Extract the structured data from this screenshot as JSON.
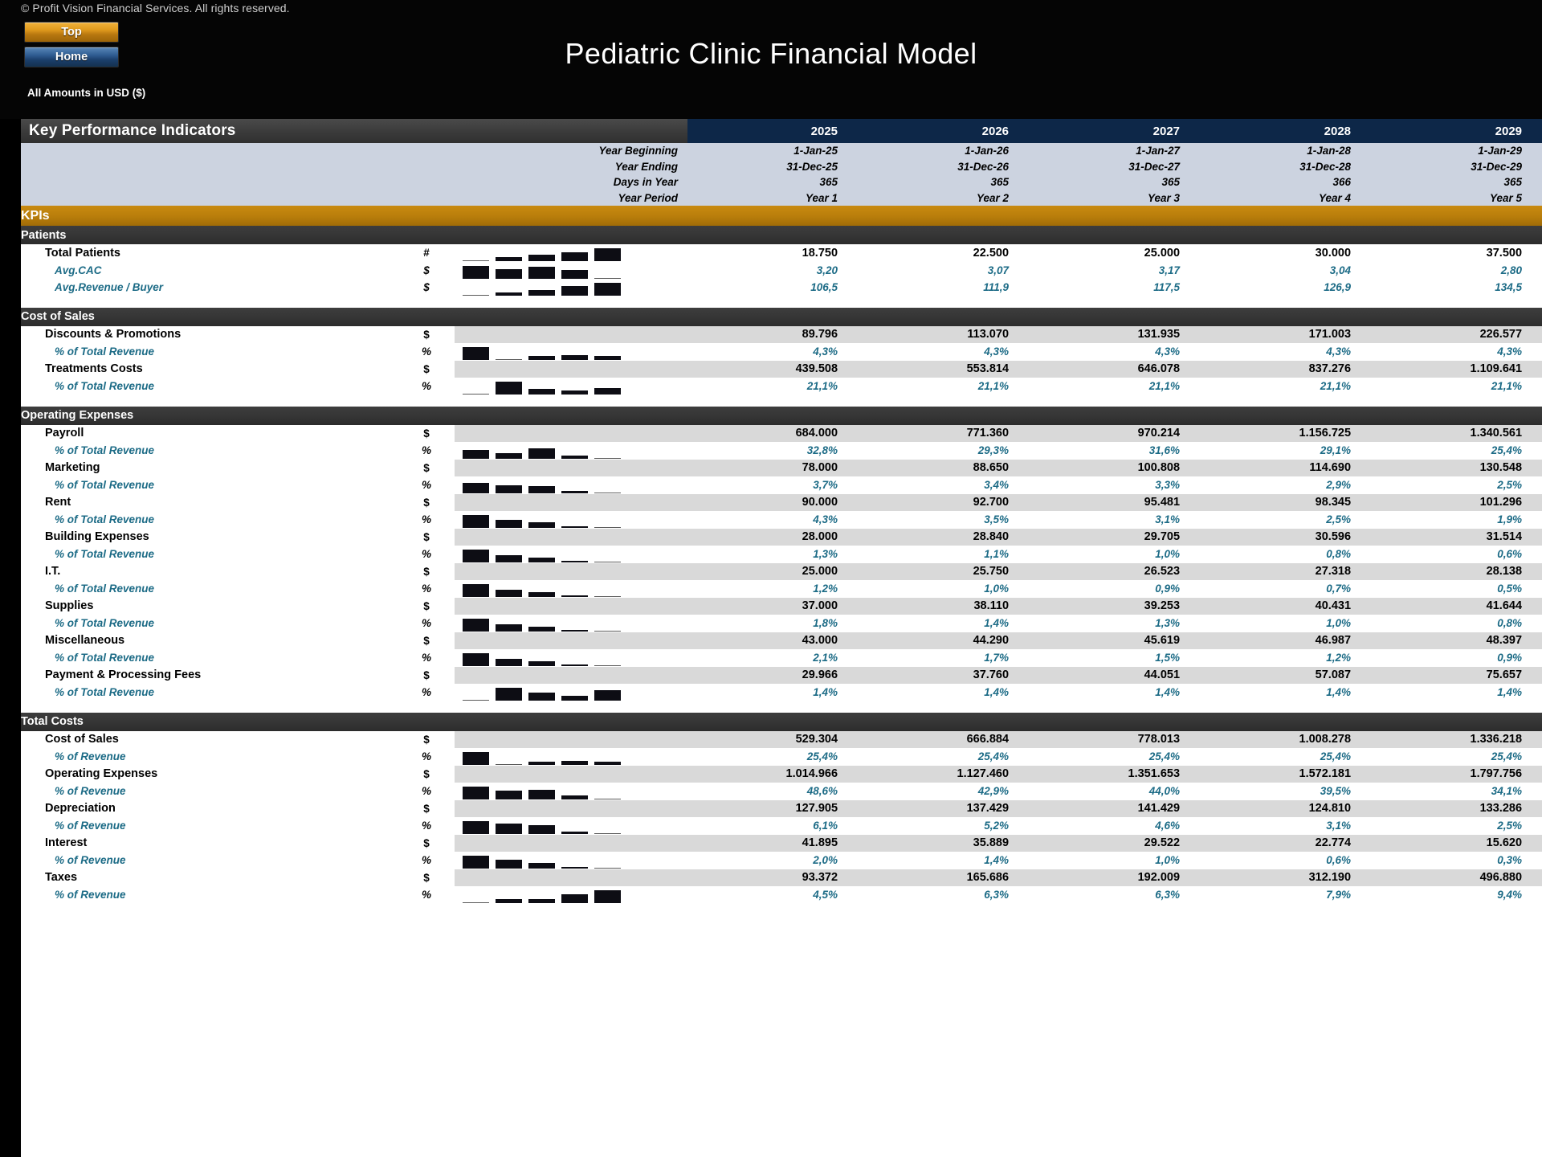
{
  "topbar": {
    "copyright": "© Profit Vision Financial Services. All rights reserved.",
    "btn_top": "Top",
    "btn_home": "Home",
    "title": "Pediatric Clinic Financial Model",
    "amounts_note": "All Amounts in  USD ($)"
  },
  "colors": {
    "year_header_bg": "#0d2748",
    "kpi_band": "#b87d0b",
    "group_band": "#353535",
    "sub_text": "#1c6b86",
    "shade_row": "#d9d9d9",
    "meta_bg": "#ccd3e0"
  },
  "table": {
    "section_title": "Key Performance Indicators",
    "years": [
      "2025",
      "2026",
      "2027",
      "2028",
      "2029"
    ],
    "meta_rows": [
      {
        "label": "Year Beginning",
        "values": [
          "1-Jan-25",
          "1-Jan-26",
          "1-Jan-27",
          "1-Jan-28",
          "1-Jan-29"
        ]
      },
      {
        "label": "Year Ending",
        "values": [
          "31-Dec-25",
          "31-Dec-26",
          "31-Dec-27",
          "31-Dec-28",
          "31-Dec-29"
        ]
      },
      {
        "label": "Days in Year",
        "values": [
          "365",
          "365",
          "365",
          "366",
          "365"
        ]
      },
      {
        "label": "Year Period",
        "values": [
          "Year 1",
          "Year 2",
          "Year 3",
          "Year 4",
          "Year 5"
        ]
      }
    ],
    "kpi_band_label": "KPIs",
    "groups": [
      {
        "name": "Patients",
        "rows": [
          {
            "label": "Total Patients",
            "unit": "#",
            "sub": false,
            "shade": false,
            "spark": [
              4,
              30,
              44,
              62,
              86
            ],
            "values": [
              "18.750",
              "22.500",
              "25.000",
              "30.000",
              "37.500"
            ]
          },
          {
            "label": "Avg.CAC",
            "unit": "$",
            "sub": true,
            "shade": false,
            "spark": [
              86,
              66,
              78,
              62,
              4
            ],
            "values": [
              "3,20",
              "3,07",
              "3,17",
              "3,04",
              "2,80"
            ]
          },
          {
            "label": "Avg.Revenue / Buyer",
            "unit": "$",
            "sub": true,
            "shade": false,
            "spark": [
              4,
              26,
              40,
              66,
              86
            ],
            "values": [
              "106,5",
              "111,9",
              "117,5",
              "126,9",
              "134,5"
            ]
          }
        ]
      },
      {
        "name": "Cost of Sales",
        "rows": [
          {
            "label": "Discounts & Promotions",
            "unit": "$",
            "sub": false,
            "shade": true,
            "spark": [],
            "values": [
              "89.796",
              "113.070",
              "131.935",
              "171.003",
              "226.577"
            ]
          },
          {
            "label": "% of Total Revenue",
            "unit": "%",
            "sub": true,
            "shade": false,
            "spark": [
              86,
              4,
              30,
              34,
              32
            ],
            "values": [
              "4,3%",
              "4,3%",
              "4,3%",
              "4,3%",
              "4,3%"
            ]
          },
          {
            "label": "Treatments Costs",
            "unit": "$",
            "sub": false,
            "shade": true,
            "spark": [],
            "values": [
              "439.508",
              "553.814",
              "646.078",
              "837.276",
              "1.109.641"
            ]
          },
          {
            "label": "% of Total Revenue",
            "unit": "%",
            "sub": true,
            "shade": false,
            "spark": [
              4,
              86,
              40,
              30,
              44
            ],
            "values": [
              "21,1%",
              "21,1%",
              "21,1%",
              "21,1%",
              "21,1%"
            ]
          }
        ]
      },
      {
        "name": "Operating Expenses",
        "rows": [
          {
            "label": "Payroll",
            "unit": "$",
            "sub": false,
            "shade": true,
            "spark": [],
            "values": [
              "684.000",
              "771.360",
              "970.214",
              "1.156.725",
              "1.340.561"
            ]
          },
          {
            "label": "% of Total Revenue",
            "unit": "%",
            "sub": true,
            "shade": false,
            "spark": [
              62,
              40,
              72,
              26,
              4
            ],
            "values": [
              "32,8%",
              "29,3%",
              "31,6%",
              "29,1%",
              "25,4%"
            ]
          },
          {
            "label": "Marketing",
            "unit": "$",
            "sub": false,
            "shade": true,
            "spark": [],
            "values": [
              "78.000",
              "88.650",
              "100.808",
              "114.690",
              "130.548"
            ]
          },
          {
            "label": "% of Total Revenue",
            "unit": "%",
            "sub": true,
            "shade": false,
            "spark": [
              72,
              56,
              50,
              22,
              4
            ],
            "values": [
              "3,7%",
              "3,4%",
              "3,3%",
              "2,9%",
              "2,5%"
            ]
          },
          {
            "label": "Rent",
            "unit": "$",
            "sub": false,
            "shade": true,
            "spark": [],
            "values": [
              "90.000",
              "92.700",
              "95.481",
              "98.345",
              "101.296"
            ]
          },
          {
            "label": "% of Total Revenue",
            "unit": "%",
            "sub": true,
            "shade": false,
            "spark": [
              86,
              56,
              38,
              16,
              4
            ],
            "values": [
              "4,3%",
              "3,5%",
              "3,1%",
              "2,5%",
              "1,9%"
            ]
          },
          {
            "label": "Building Expenses",
            "unit": "$",
            "sub": false,
            "shade": true,
            "spark": [],
            "values": [
              "28.000",
              "28.840",
              "29.705",
              "30.596",
              "31.514"
            ]
          },
          {
            "label": "% of Total Revenue",
            "unit": "%",
            "sub": true,
            "shade": false,
            "spark": [
              86,
              48,
              36,
              14,
              4
            ],
            "values": [
              "1,3%",
              "1,1%",
              "1,0%",
              "0,8%",
              "0,6%"
            ]
          },
          {
            "label": "I.T.",
            "unit": "$",
            "sub": false,
            "shade": true,
            "spark": [],
            "values": [
              "25.000",
              "25.750",
              "26.523",
              "27.318",
              "28.138"
            ]
          },
          {
            "label": "% of Total Revenue",
            "unit": "%",
            "sub": true,
            "shade": false,
            "spark": [
              86,
              50,
              34,
              14,
              4
            ],
            "values": [
              "1,2%",
              "1,0%",
              "0,9%",
              "0,7%",
              "0,5%"
            ]
          },
          {
            "label": "Supplies",
            "unit": "$",
            "sub": false,
            "shade": true,
            "spark": [],
            "values": [
              "37.000",
              "38.110",
              "39.253",
              "40.431",
              "41.644"
            ]
          },
          {
            "label": "% of Total Revenue",
            "unit": "%",
            "sub": true,
            "shade": false,
            "spark": [
              86,
              50,
              34,
              14,
              4
            ],
            "values": [
              "1,8%",
              "1,4%",
              "1,3%",
              "1,0%",
              "0,8%"
            ]
          },
          {
            "label": "Miscellaneous",
            "unit": "$",
            "sub": false,
            "shade": true,
            "spark": [],
            "values": [
              "43.000",
              "44.290",
              "45.619",
              "46.987",
              "48.397"
            ]
          },
          {
            "label": "% of Total Revenue",
            "unit": "%",
            "sub": true,
            "shade": false,
            "spark": [
              86,
              50,
              34,
              14,
              4
            ],
            "values": [
              "2,1%",
              "1,7%",
              "1,5%",
              "1,2%",
              "0,9%"
            ]
          },
          {
            "label": "Payment & Processing Fees",
            "unit": "$",
            "sub": false,
            "shade": true,
            "spark": [],
            "values": [
              "29.966",
              "37.760",
              "44.051",
              "57.087",
              "75.657"
            ]
          },
          {
            "label": "% of Total Revenue",
            "unit": "%",
            "sub": true,
            "shade": false,
            "spark": [
              4,
              86,
              56,
              36,
              72
            ],
            "values": [
              "1,4%",
              "1,4%",
              "1,4%",
              "1,4%",
              "1,4%"
            ]
          }
        ]
      },
      {
        "name": "Total Costs",
        "rows": [
          {
            "label": "Cost of Sales",
            "unit": "$",
            "sub": false,
            "shade": true,
            "spark": [],
            "values": [
              "529.304",
              "666.884",
              "778.013",
              "1.008.278",
              "1.336.218"
            ]
          },
          {
            "label": "% of Revenue",
            "unit": "%",
            "sub": true,
            "shade": false,
            "spark": [
              86,
              4,
              26,
              30,
              24
            ],
            "values": [
              "25,4%",
              "25,4%",
              "25,4%",
              "25,4%",
              "25,4%"
            ]
          },
          {
            "label": "Operating Expenses",
            "unit": "$",
            "sub": false,
            "shade": true,
            "spark": [],
            "values": [
              "1.014.966",
              "1.127.460",
              "1.351.653",
              "1.572.181",
              "1.797.756"
            ]
          },
          {
            "label": "% of Revenue",
            "unit": "%",
            "sub": true,
            "shade": false,
            "spark": [
              86,
              58,
              64,
              28,
              4
            ],
            "values": [
              "48,6%",
              "42,9%",
              "44,0%",
              "39,5%",
              "34,1%"
            ]
          },
          {
            "label": "Depreciation",
            "unit": "$",
            "sub": false,
            "shade": true,
            "spark": [],
            "values": [
              "127.905",
              "137.429",
              "141.429",
              "124.810",
              "133.286"
            ]
          },
          {
            "label": "% of Revenue",
            "unit": "%",
            "sub": true,
            "shade": false,
            "spark": [
              86,
              70,
              58,
              22,
              4
            ],
            "values": [
              "6,1%",
              "5,2%",
              "4,6%",
              "3,1%",
              "2,5%"
            ]
          },
          {
            "label": "Interest",
            "unit": "$",
            "sub": false,
            "shade": true,
            "spark": [],
            "values": [
              "41.895",
              "35.889",
              "29.522",
              "22.774",
              "15.620"
            ]
          },
          {
            "label": "% of Revenue",
            "unit": "%",
            "sub": true,
            "shade": false,
            "spark": [
              86,
              60,
              38,
              16,
              4
            ],
            "values": [
              "2,0%",
              "1,4%",
              "1,0%",
              "0,6%",
              "0,3%"
            ]
          },
          {
            "label": "Taxes",
            "unit": "$",
            "sub": false,
            "shade": true,
            "spark": [],
            "values": [
              "93.372",
              "165.686",
              "192.009",
              "312.190",
              "496.880"
            ]
          },
          {
            "label": "% of Revenue",
            "unit": "%",
            "sub": true,
            "shade": false,
            "spark": [
              4,
              30,
              32,
              60,
              86
            ],
            "values": [
              "4,5%",
              "6,3%",
              "6,3%",
              "7,9%",
              "9,4%"
            ]
          }
        ]
      }
    ]
  }
}
